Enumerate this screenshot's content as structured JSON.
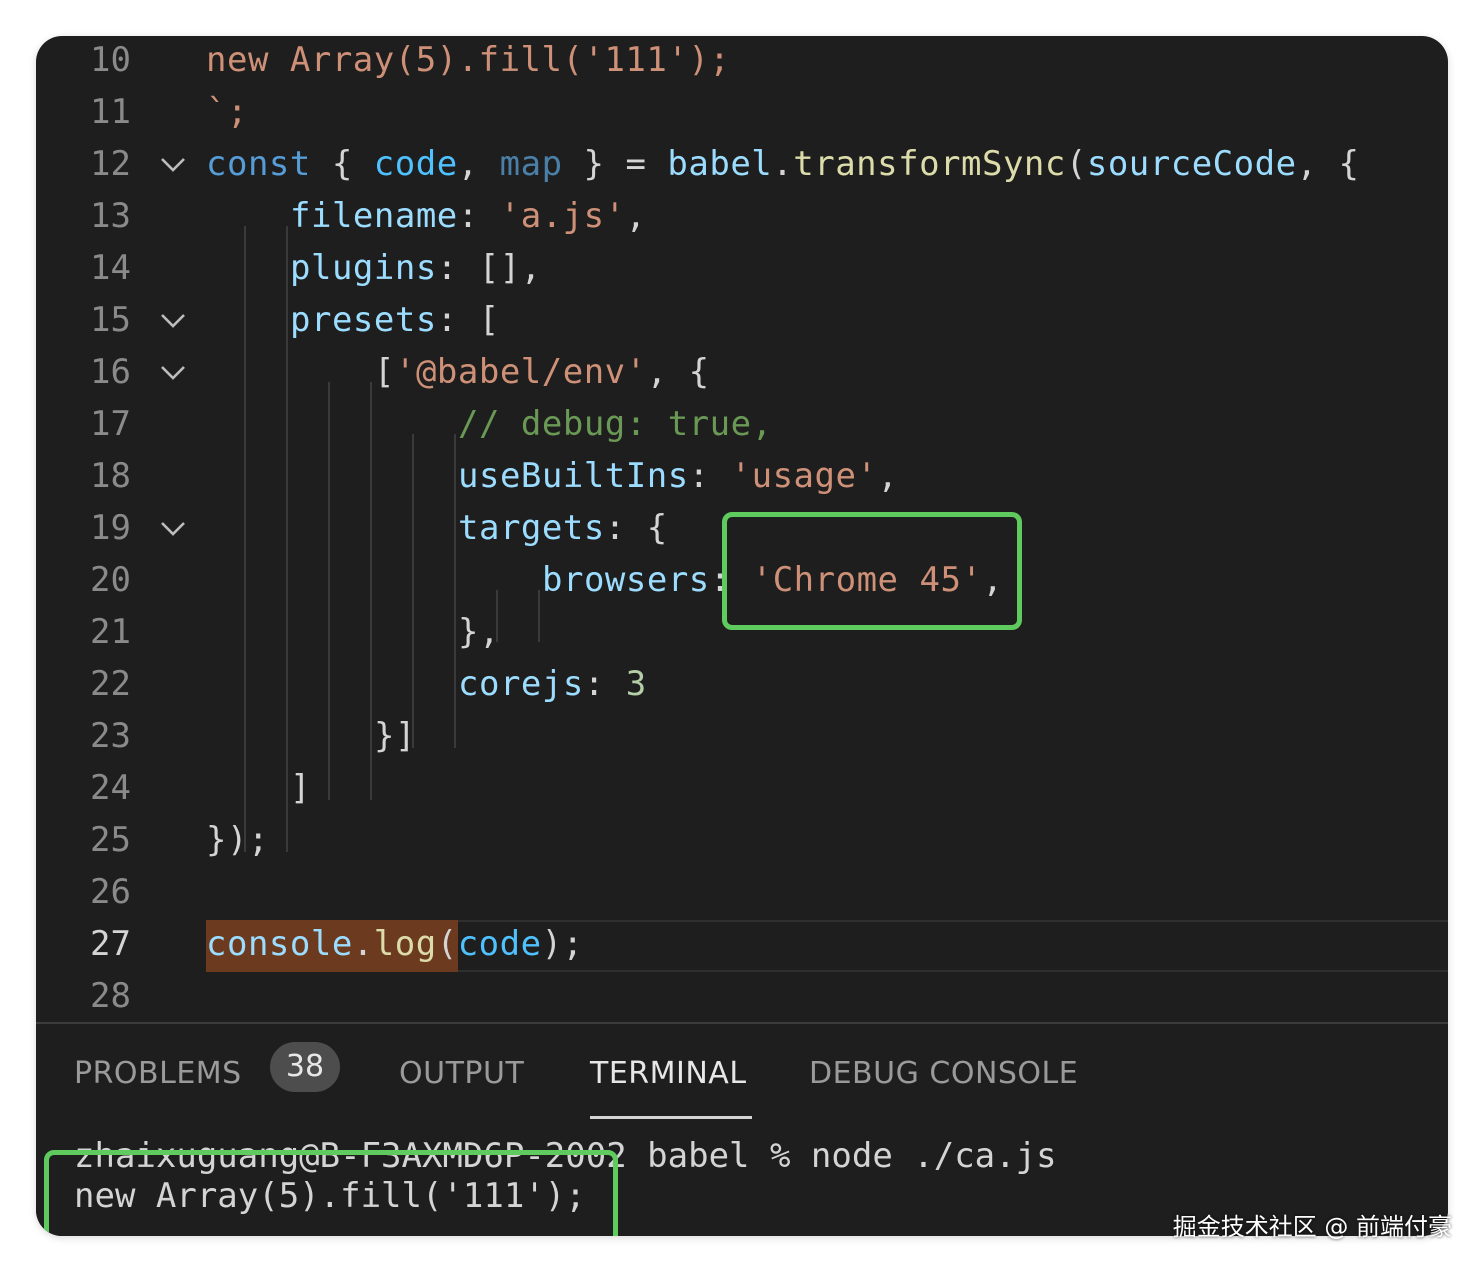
{
  "editor": {
    "lines": [
      {
        "n": "10"
      },
      {
        "n": "11"
      },
      {
        "n": "12"
      },
      {
        "n": "13"
      },
      {
        "n": "14"
      },
      {
        "n": "15"
      },
      {
        "n": "16"
      },
      {
        "n": "17"
      },
      {
        "n": "18"
      },
      {
        "n": "19"
      },
      {
        "n": "20"
      },
      {
        "n": "21"
      },
      {
        "n": "22"
      },
      {
        "n": "23"
      },
      {
        "n": "24"
      },
      {
        "n": "25"
      },
      {
        "n": "26"
      },
      {
        "n": "27"
      },
      {
        "n": "28"
      }
    ],
    "code": {
      "l10_new": "new ",
      "l10_rest": "Array(5).fill(",
      "l10_str": "'111'",
      "l10_end": ");",
      "l11": "`;",
      "l12_const": "const",
      "l12_open": " { ",
      "l12_code": "code",
      "l12_comma": ", ",
      "l12_map": "map",
      "l12_close": " } = ",
      "l12_babel": "babel",
      "l12_dot": ".",
      "l12_fn": "transformSync",
      "l12_paren": "(",
      "l12_src": "sourceCode",
      "l12_end": ", {",
      "l13_key": "filename",
      "l13_colon": ": ",
      "l13_str": "'a.js'",
      "l13_end": ",",
      "l14_key": "plugins",
      "l14_rest": ": [],",
      "l15_key": "presets",
      "l15_rest": ": [",
      "l16_open": "[",
      "l16_str": "'@babel/env'",
      "l16_rest": ", {",
      "l17_cmt": "// debug: true,",
      "l18_key": "useBuiltIns",
      "l18_colon": ": ",
      "l18_str": "'usage'",
      "l18_end": ",",
      "l19_key": "targets",
      "l19_rest": ": {",
      "l20_key": "browsers",
      "l20_colon": ": ",
      "l20_str": "'Chrome 45'",
      "l20_end": ",",
      "l21": "},",
      "l22_key": "corejs",
      "l22_colon": ": ",
      "l22_num": "3",
      "l23": "}]",
      "l24": "]",
      "l25": "});",
      "l27_console": "console",
      "l27_dot": ".",
      "l27_log": "log",
      "l27_paren": "(",
      "l27_code": "code",
      "l27_end": ");"
    }
  },
  "panel": {
    "tabs": {
      "problems": "PROBLEMS",
      "problems_count": "38",
      "output": "OUTPUT",
      "terminal": "TERMINAL",
      "debug_console": "DEBUG CONSOLE"
    },
    "terminal": {
      "line1_prompt": "zhaixuguang@B-F3AXMD6P-2002",
      "line1_rest": " babel % node ./ca.js",
      "line2": "new Array(5).fill('111');"
    }
  },
  "watermark": "掘金技术社区 @ 前端付豪",
  "colors": {
    "highlight_box": "#5fcb5f",
    "background": "#1e1e1e",
    "selection": "#6b3a1f"
  },
  "icons": {
    "fold": "chevron-down-icon"
  }
}
